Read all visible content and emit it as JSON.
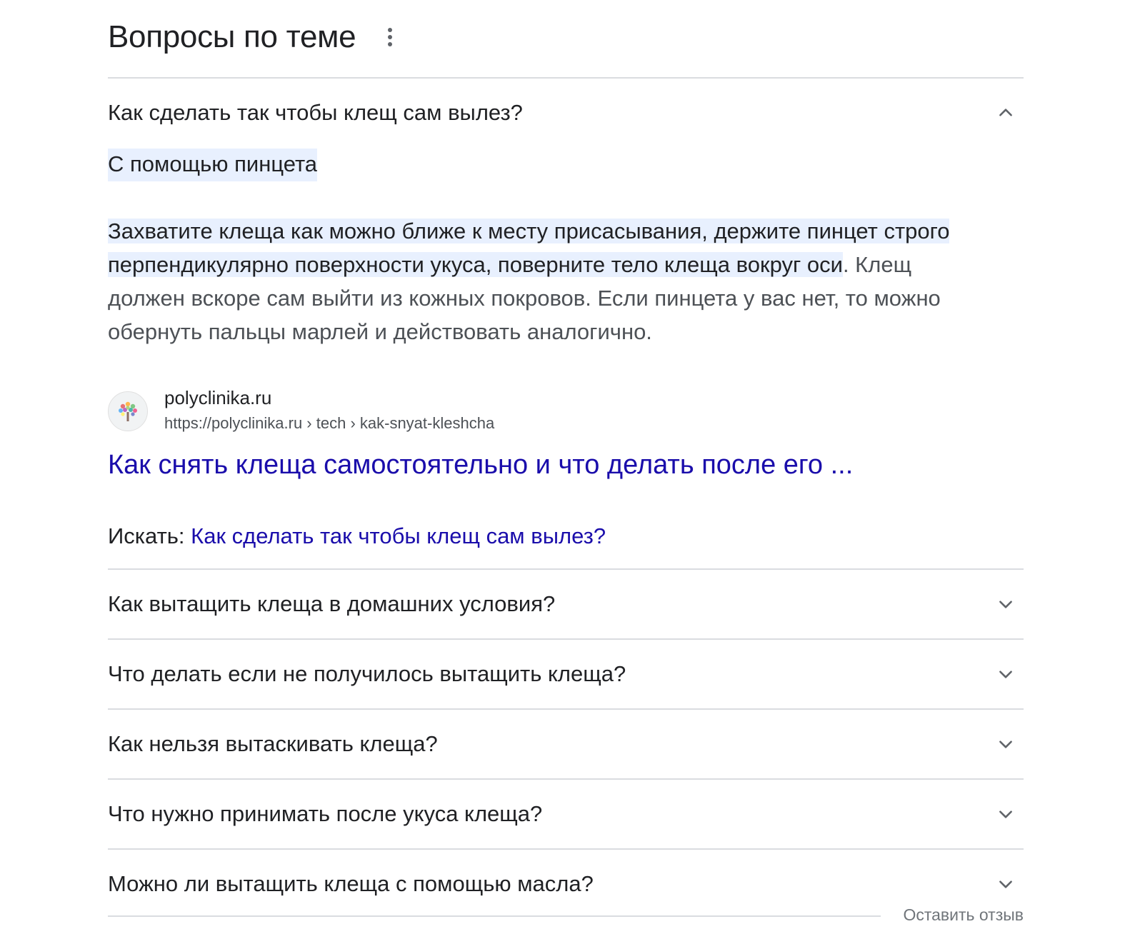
{
  "header": {
    "title": "Вопросы по теме"
  },
  "open_question": {
    "question": "Как сделать так чтобы клещ сам вылез?",
    "answer_title": "С помощью пинцета",
    "answer_highlight": "Захватите клеща как можно ближе к месту присасывания, держите пинцет строго перпендикулярно поверхности укуса, поверните тело клеща вокруг оси",
    "answer_rest": ". Клещ должен вскоре сам выйти из кожных покровов. Если пинцета у вас нет, то можно обернуть пальцы марлей и действовать аналогично.",
    "source": {
      "name": "polyclinika.ru",
      "url": "https://polyclinika.ru › tech › kak-snyat-kleshcha",
      "favicon": "tree-logo-icon"
    },
    "result_title": "Как снять клеща самостоятельно и что делать после его ...",
    "search_label": "Искать: ",
    "search_query": "Как сделать так чтобы клещ сам вылез?"
  },
  "questions": [
    "Как вытащить клеща в домашних условия?",
    "Что делать если не получилось вытащить клеща?",
    "Как нельзя вытаскивать клеща?",
    "Что нужно принимать после укуса клеща?",
    "Можно ли вытащить клеща с помощью масла?"
  ],
  "footer": {
    "feedback": "Оставить отзыв"
  },
  "colors": {
    "link": "#1a0dab",
    "highlight": "#e8f0fe",
    "divider": "#dadce0"
  }
}
